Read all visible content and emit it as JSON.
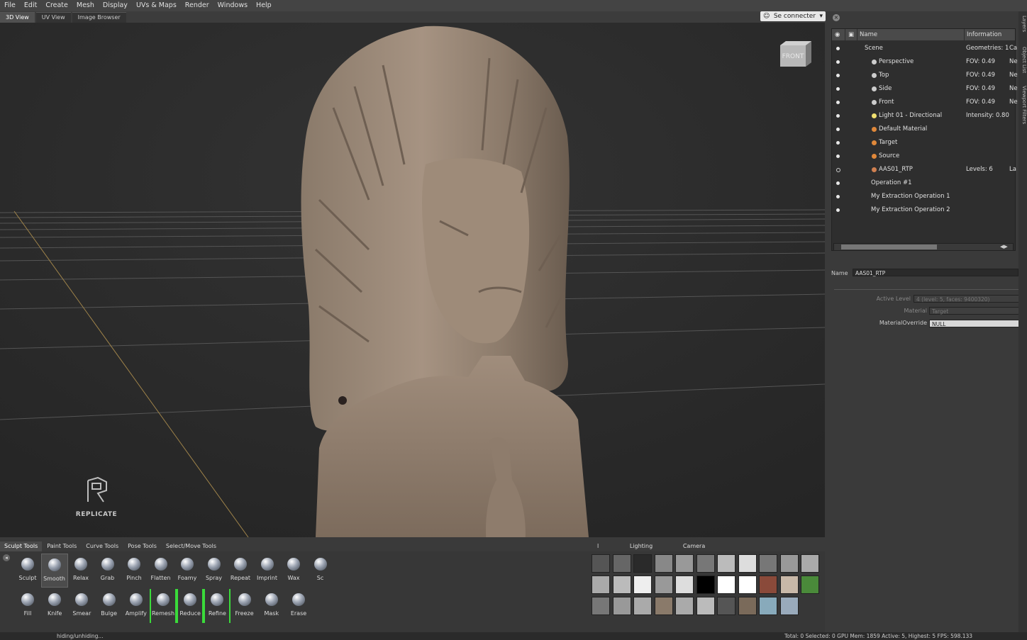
{
  "menu": [
    "File",
    "Edit",
    "Create",
    "Mesh",
    "Display",
    "UVs & Maps",
    "Render",
    "Windows",
    "Help"
  ],
  "view_tabs": [
    "3D View",
    "UV View",
    "Image Browser"
  ],
  "login": {
    "label": "Se connecter"
  },
  "viewcube": {
    "label": "FRONT"
  },
  "logo": {
    "text": "REPLICATE"
  },
  "side_tabs": [
    "Layers",
    "Object List",
    "Viewport Filters"
  ],
  "tree": {
    "headers": {
      "name": "Name",
      "info": "Information"
    },
    "rows": [
      {
        "name": "Scene",
        "info": "Geometries: 1",
        "info2": "Ca",
        "visible": true
      },
      {
        "name": "Perspective",
        "info": "FOV: 0.49",
        "info2": "Ne",
        "visible": true
      },
      {
        "name": "Top",
        "info": "FOV: 0.49",
        "info2": "Ne",
        "visible": true
      },
      {
        "name": "Side",
        "info": "FOV: 0.49",
        "info2": "Ne",
        "visible": true
      },
      {
        "name": "Front",
        "info": "FOV: 0.49",
        "info2": "Ne",
        "visible": true
      },
      {
        "name": "Light 01 - Directional",
        "info": "Intensity: 0.80",
        "info2": "",
        "visible": true
      },
      {
        "name": "Default Material",
        "info": "",
        "info2": "",
        "visible": true
      },
      {
        "name": "Target",
        "info": "",
        "info2": "",
        "visible": true
      },
      {
        "name": "Source",
        "info": "",
        "info2": "",
        "visible": true
      },
      {
        "name": "AAS01_RTP",
        "info": "Levels: 6",
        "info2": "La",
        "visible": false
      },
      {
        "name": "Operation #1",
        "info": "",
        "info2": "",
        "visible": true
      },
      {
        "name": "My Extraction Operation 1",
        "info": "",
        "info2": "",
        "visible": true
      },
      {
        "name": "My Extraction Operation 2",
        "info": "",
        "info2": "",
        "visible": true
      }
    ]
  },
  "properties": {
    "name_label": "Name",
    "name_value": "AAS01_RTP",
    "active_level_label": "Active Level",
    "active_level_value": "4 (level: 5, faces: 9400320)",
    "material_label": "Material",
    "material_value": "Target",
    "override_label": "MaterialOverride",
    "override_value": "NULL"
  },
  "tool_tabs": [
    "Sculpt Tools",
    "Paint Tools",
    "Curve Tools",
    "Pose Tools",
    "Select/Move Tools"
  ],
  "tools_row1": [
    "Sculpt",
    "Smooth",
    "Relax",
    "Grab",
    "Pinch",
    "Flatten",
    "Foamy",
    "Spray",
    "Repeat",
    "Imprint",
    "Wax",
    "Sc"
  ],
  "tools_row2": [
    "Fill",
    "Knife",
    "Smear",
    "Bulge",
    "Amplify",
    "Remesh",
    "Reduce",
    "Refine",
    "Freeze",
    "Mask",
    "Erase"
  ],
  "preset_tabs": [
    "l Presets",
    "Lighting Presets",
    "Camera Bookmarks"
  ],
  "status": {
    "left": "hiding/unhiding...",
    "right": "Total: 0  Selected: 0 GPU Mem: 1859  Active: 5, Highest: 5  FPS: 598.133"
  }
}
